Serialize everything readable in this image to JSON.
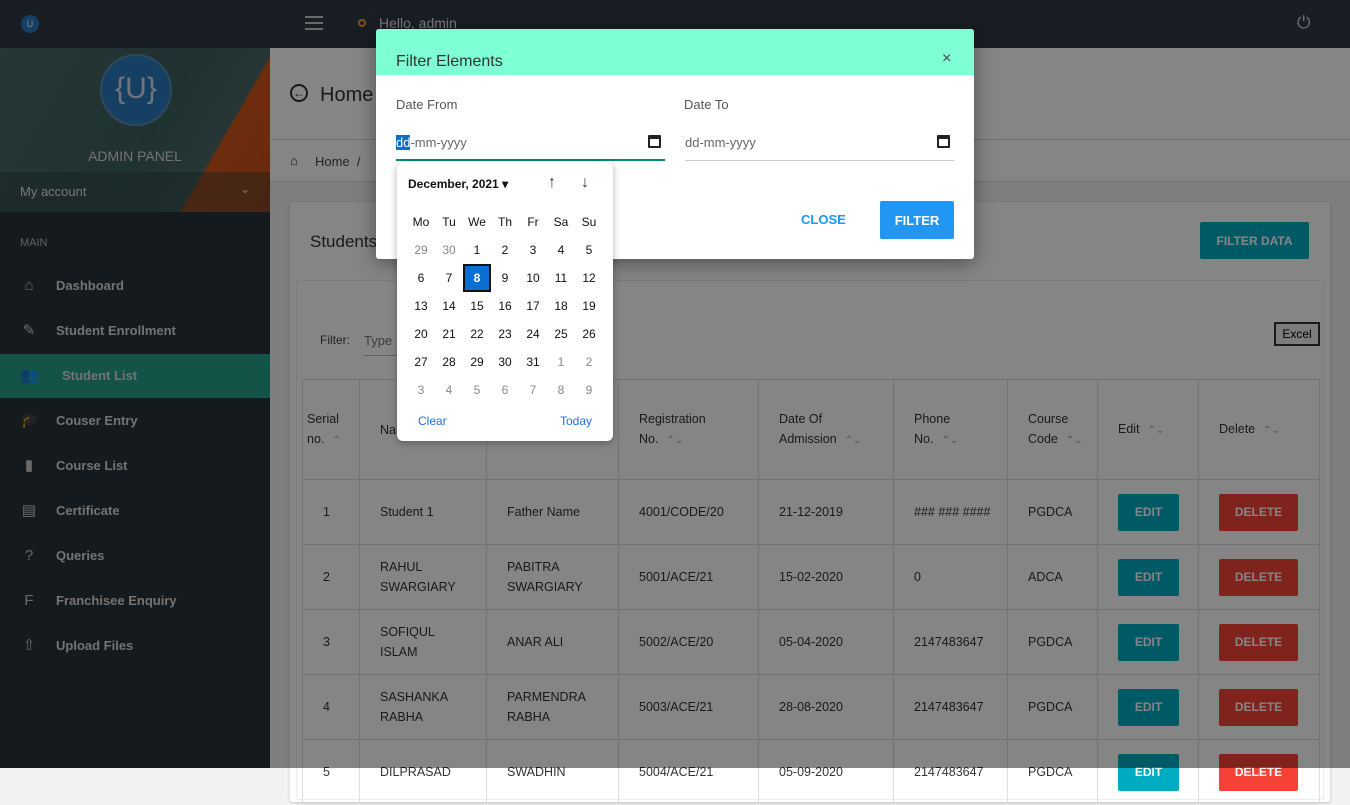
{
  "topbar": {
    "greeting": "Hello, admin",
    "logo": "U"
  },
  "sidebar": {
    "logo": "{U}",
    "title": "ADMIN PANEL",
    "account": "My account",
    "section": "MAIN",
    "items": [
      {
        "label": "Dashboard",
        "icon": "home-icon",
        "glyph": "⌂"
      },
      {
        "label": "Student Enrollment",
        "icon": "edit-icon",
        "glyph": "✎"
      },
      {
        "label": "Student List",
        "icon": "users-icon",
        "glyph": "👥",
        "active": true
      },
      {
        "label": "Couser Entry",
        "icon": "graduation-cap-icon",
        "glyph": "🎓"
      },
      {
        "label": "Course List",
        "icon": "notebook-icon",
        "glyph": "▮"
      },
      {
        "label": "Certificate",
        "icon": "certificate-icon",
        "glyph": "▤"
      },
      {
        "label": "Queries",
        "icon": "question-icon",
        "glyph": "?"
      },
      {
        "label": "Franchisee Enquiry",
        "icon": "franchise-icon",
        "glyph": "F"
      },
      {
        "label": "Upload Files",
        "icon": "upload-file-icon",
        "glyph": "⇧"
      }
    ]
  },
  "page": {
    "title": "Home",
    "breadcrumb": "Home",
    "separator": "/",
    "card_title": "Students",
    "filter_data": "FILTER DATA",
    "filter_label": "Filter:",
    "filter_placeholder": "Type",
    "excel": "Excel"
  },
  "table": {
    "headers": [
      "Serial no.",
      "Name",
      "",
      "Registration No.",
      "Date Of Admission",
      "Phone No.",
      "Course Code",
      "Edit",
      "Delete"
    ],
    "rows": [
      [
        "1",
        "Student 1",
        "Father Name",
        "4001/CODE/20",
        "21-12-2019",
        "### ### ####",
        "PGDCA"
      ],
      [
        "2",
        "RAHUL SWARGIARY",
        "PABITRA SWARGIARY",
        "5001/ACE/21",
        "15-02-2020",
        "0",
        "ADCA"
      ],
      [
        "3",
        "SOFIQUL ISLAM",
        "ANAR ALI",
        "5002/ACE/20",
        "05-04-2020",
        "2147483647",
        "PGDCA"
      ],
      [
        "4",
        "SASHANKA RABHA",
        "PARMENDRA RABHA",
        "5003/ACE/21",
        "28-08-2020",
        "2147483647",
        "PGDCA"
      ],
      [
        "5",
        "DILPRASAD",
        "SWADHIN",
        "5004/ACE/21",
        "05-09-2020",
        "2147483647",
        "PGDCA"
      ]
    ],
    "edit": "EDIT",
    "delete": "DELETE"
  },
  "modal": {
    "title": "Filter Elements",
    "close_x": "×",
    "date_from_label": "Date From",
    "date_to_label": "Date To",
    "date_from_value": "dd-mm-yyyy",
    "date_to_value": "dd-mm-yyyy",
    "close": "CLOSE",
    "filter": "FILTER",
    "header_color": "#7fffd4"
  },
  "calendar": {
    "month": "December, 2021",
    "weekdays": [
      "Mo",
      "Tu",
      "We",
      "Th",
      "Fr",
      "Sa",
      "Su"
    ],
    "selected": "8",
    "days": [
      "29",
      "30",
      "1",
      "2",
      "3",
      "4",
      "5",
      "6",
      "7",
      "8",
      "9",
      "10",
      "11",
      "12",
      "13",
      "14",
      "15",
      "16",
      "17",
      "18",
      "19",
      "20",
      "21",
      "22",
      "23",
      "24",
      "25",
      "26",
      "27",
      "28",
      "29",
      "30",
      "31",
      "1",
      "2",
      "3",
      "4",
      "5",
      "6",
      "7",
      "8",
      "9"
    ],
    "clear": "Clear",
    "today": "Today"
  }
}
